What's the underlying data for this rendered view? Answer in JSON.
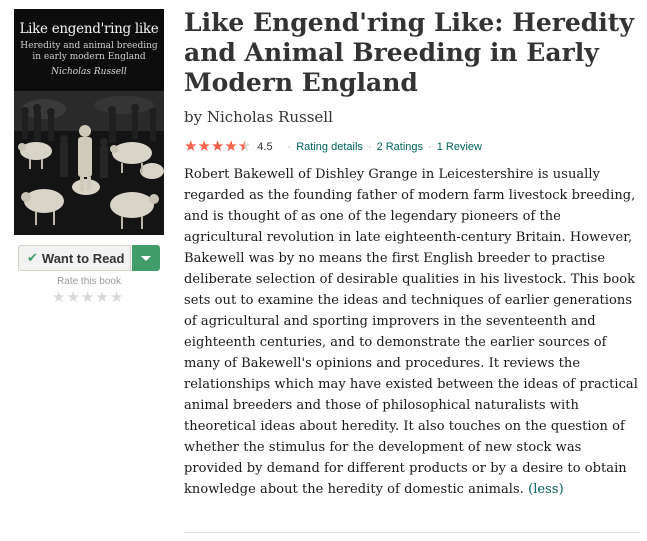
{
  "book": {
    "title": "Like Engend'ring Like: Heredity and Animal Breeding in Early Modern England",
    "by_prefix": "by",
    "author": "Nicholas Russell",
    "rating_value": 4.5,
    "avg_rating": "4.5",
    "rating_details_label": "Rating details",
    "ratings_label": "2 Ratings",
    "reviews_label": "1 Review",
    "separator": "·",
    "description": "Robert Bakewell of Dishley Grange in Leicestershire is usually regarded as the founding father of modern farm livestock breeding, and is thought of as one of the legendary pioneers of the agricultural revolution in late eighteenth-century Britain. However, Bakewell was by no means the first English breeder to practise deliberate selection of desirable qualities in his livestock. This book sets out to examine the ideas and techniques of earlier generations of agricultural and sporting improvers in the seventeenth and eighteenth centuries, and to demonstrate the earlier sources of many of Bakewell's opinions and procedures. It reviews the relationships which may have existed between the ideas of practical animal breeders and those of philosophical naturalists with theoretical ideas about heredity. It also touches on the question of whether the stimulus for the development of new stock was provided by demand for different products or by a desire to obtain knowledge about the heredity of domestic animals.",
    "less_label": "(less)"
  },
  "cover": {
    "title": "Like engend'ring like",
    "subtitle_line1": "Heredity and animal breeding",
    "subtitle_line2": "in early modern England",
    "author": "Nicholas Russell"
  },
  "shelf": {
    "want_to_read_label": "Want to Read",
    "check_icon": "check-icon",
    "dropdown_icon": "caret-down-icon",
    "rate_label": "Rate this book"
  },
  "colors": {
    "star_filled": "#fa604a",
    "star_empty": "#d9d9d9",
    "green": "#409d69",
    "link": "#00635d"
  }
}
